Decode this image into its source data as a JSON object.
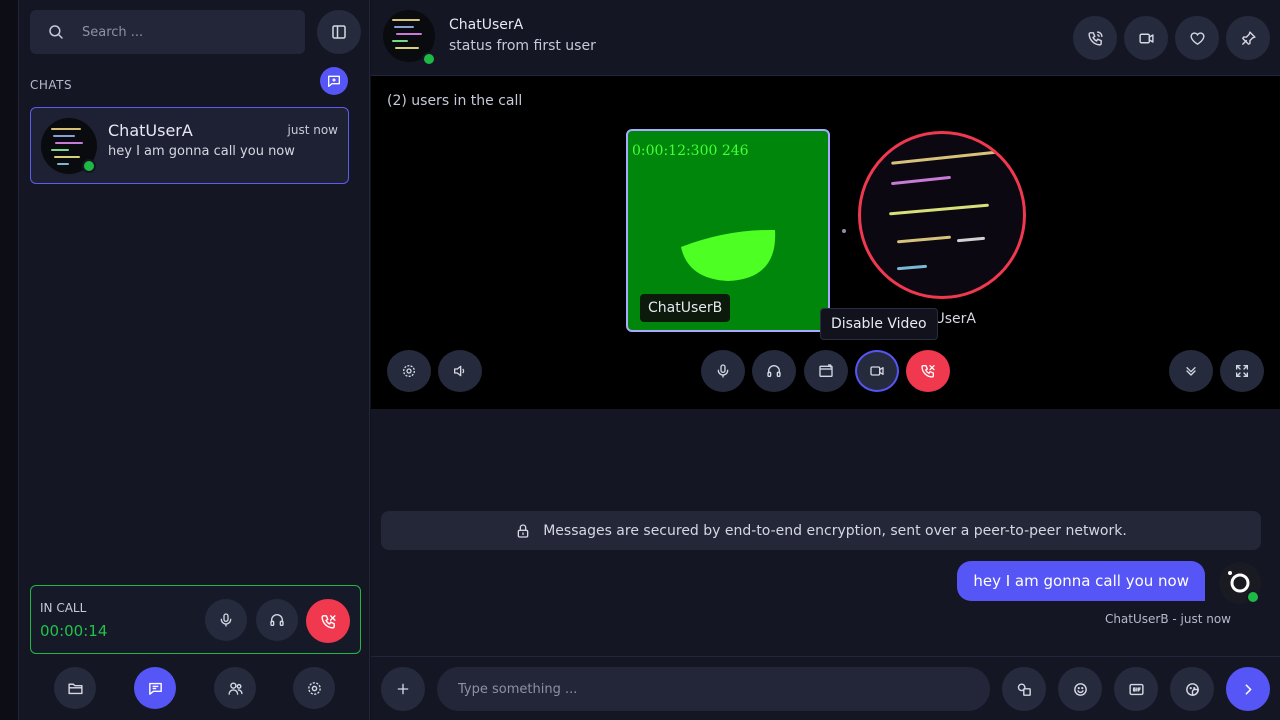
{
  "sidebar": {
    "search_placeholder": "Search ...",
    "chats_label": "CHATS",
    "chats": [
      {
        "name": "ChatUserA",
        "time": "just now",
        "last_message": "hey I am gonna call you now"
      }
    ],
    "in_call": {
      "label": "IN CALL",
      "timer": "00:00:14"
    },
    "nav": [
      "folder-icon",
      "chat-icon",
      "users-icon",
      "settings-icon"
    ]
  },
  "header": {
    "name": "ChatUserA",
    "status": "status from first user"
  },
  "call": {
    "users_count": "(2) users in the call",
    "tile_b": {
      "timestamp": "0:00:12:300 246",
      "name": "ChatUserB"
    },
    "tile_a": {
      "name": "ChatUserA",
      "name_visible": "tUserA"
    },
    "tooltip": "Disable Video"
  },
  "messages": {
    "encryption_notice": "Messages are secured by end-to-end encryption, sent over a peer-to-peer network.",
    "items": [
      {
        "text": "hey I am gonna call you now",
        "meta": "ChatUserB - just now"
      }
    ]
  },
  "composer": {
    "placeholder": "Type something ..."
  },
  "colors": {
    "accent": "#5655f5",
    "danger": "#f0384f",
    "online": "#1fb845",
    "video_bg": "#00870b"
  }
}
